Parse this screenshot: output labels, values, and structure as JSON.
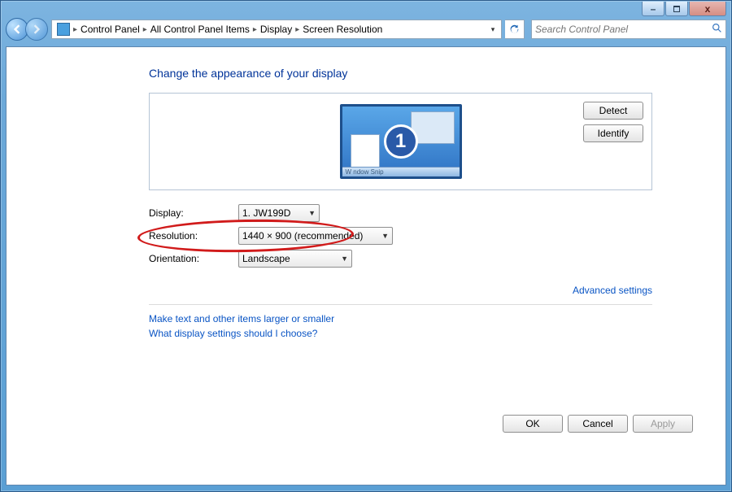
{
  "titlebar": {
    "minimize": "–",
    "close": "x"
  },
  "breadcrumbs": [
    "Control Panel",
    "All Control Panel Items",
    "Display",
    "Screen Resolution"
  ],
  "search": {
    "placeholder": "Search Control Panel"
  },
  "page": {
    "title": "Change the appearance of your display",
    "monitor_number": "1",
    "taskbar_text": "W ndow Snip",
    "detect_btn": "Detect",
    "identify_btn": "Identify"
  },
  "form": {
    "display_label": "Display:",
    "display_value": "1. JW199D",
    "resolution_label": "Resolution:",
    "resolution_value": "1440 × 900 (recommended)",
    "orientation_label": "Orientation:",
    "orientation_value": "Landscape"
  },
  "links": {
    "advanced": "Advanced settings",
    "larger": "Make text and other items larger or smaller",
    "help": "What display settings should I choose?"
  },
  "footer": {
    "ok": "OK",
    "cancel": "Cancel",
    "apply": "Apply"
  }
}
